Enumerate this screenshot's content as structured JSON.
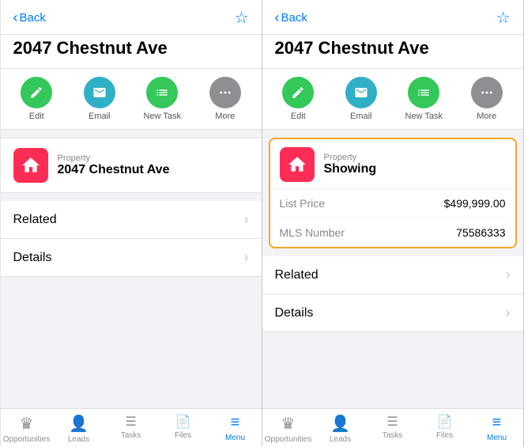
{
  "panel1": {
    "header": {
      "back_label": "Back",
      "star_icon": "☆"
    },
    "title": "2047 Chestnut Ave",
    "actions": [
      {
        "id": "edit",
        "label": "Edit",
        "icon": "✏️",
        "color": "green"
      },
      {
        "id": "email",
        "label": "Email",
        "icon": "✉️",
        "color": "green-teal"
      },
      {
        "id": "new-task",
        "label": "New Task",
        "icon": "≡",
        "color": "green2"
      },
      {
        "id": "more",
        "label": "More",
        "icon": "•••",
        "color": "gray"
      }
    ],
    "property_card": {
      "type_label": "Property",
      "name": "2047 Chestnut Ave"
    },
    "sections": [
      {
        "id": "related",
        "label": "Related"
      },
      {
        "id": "details",
        "label": "Details"
      }
    ],
    "bottom_nav": [
      {
        "id": "opportunities",
        "label": "Opportunities",
        "icon": "🏆",
        "active": false
      },
      {
        "id": "leads",
        "label": "Leads",
        "icon": "👤",
        "active": false
      },
      {
        "id": "tasks",
        "label": "Tasks",
        "icon": "☰",
        "active": false
      },
      {
        "id": "files",
        "label": "Files",
        "icon": "📄",
        "active": false
      },
      {
        "id": "menu",
        "label": "Menu",
        "icon": "≡",
        "active": true
      }
    ]
  },
  "panel2": {
    "header": {
      "back_label": "Back",
      "star_icon": "☆"
    },
    "title": "2047 Chestnut Ave",
    "actions": [
      {
        "id": "edit",
        "label": "Edit",
        "icon": "✏️",
        "color": "green"
      },
      {
        "id": "email",
        "label": "Email",
        "icon": "✉️",
        "color": "green-teal"
      },
      {
        "id": "new-task",
        "label": "New Task",
        "icon": "≡",
        "color": "green2"
      },
      {
        "id": "more",
        "label": "More",
        "icon": "•••",
        "color": "gray"
      }
    ],
    "property_card": {
      "type_label": "Property",
      "name": "Showing"
    },
    "details": [
      {
        "label": "List Price",
        "value": "$499,999.00"
      },
      {
        "label": "MLS Number",
        "value": "75586333"
      }
    ],
    "sections": [
      {
        "id": "related",
        "label": "Related"
      },
      {
        "id": "details",
        "label": "Details"
      }
    ],
    "bottom_nav": [
      {
        "id": "opportunities",
        "label": "Opportunities",
        "icon": "🏆",
        "active": false
      },
      {
        "id": "leads",
        "label": "Leads",
        "icon": "👤",
        "active": false
      },
      {
        "id": "tasks",
        "label": "Tasks",
        "icon": "☰",
        "active": false
      },
      {
        "id": "files",
        "label": "Files",
        "icon": "📄",
        "active": false
      },
      {
        "id": "menu",
        "label": "Menu",
        "icon": "≡",
        "active": true
      }
    ]
  }
}
